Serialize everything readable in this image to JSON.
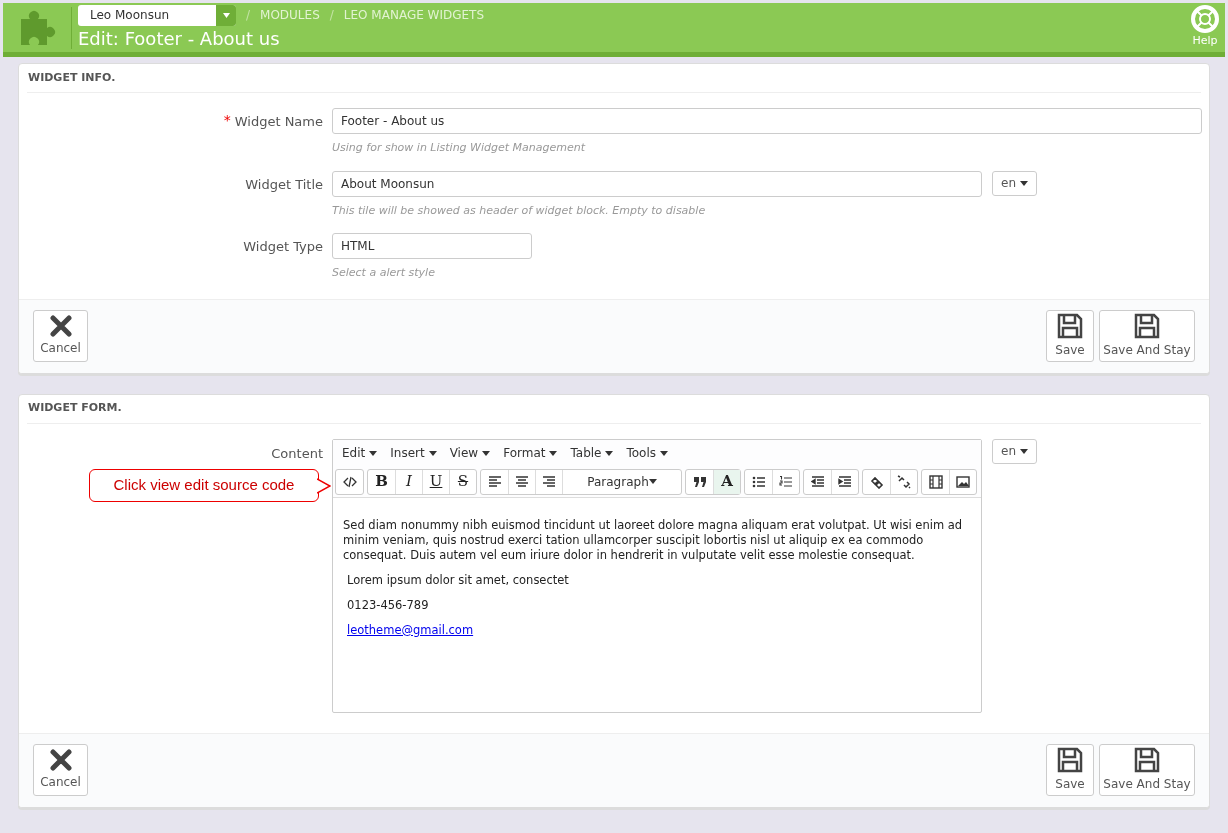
{
  "header": {
    "shop_select": "Leo Moonsun",
    "breadcrumbs": [
      {
        "separator": "/",
        "label": "MODULES"
      },
      {
        "separator": "/",
        "label": "LEO MANAGE WIDGETS"
      }
    ],
    "title": "Edit: Footer - About us",
    "help": "Help"
  },
  "widget_info": {
    "heading": "WIDGET INFO.",
    "fields": [
      {
        "label": "Widget Name",
        "required_mark": "*",
        "value": "Footer - About us",
        "hint": "Using for show in Listing Widget Management"
      },
      {
        "label": "Widget Title",
        "value": "About Moonsun",
        "hint": "This tile will be showed as header of widget block. Empty to disable",
        "lang": "en"
      },
      {
        "label": "Widget Type",
        "value": "HTML",
        "hint": "Select a alert style"
      }
    ],
    "buttons": {
      "cancel": "Cancel",
      "save": "Save",
      "save_stay": "Save And Stay"
    }
  },
  "widget_form": {
    "heading": "WIDGET FORM.",
    "label": "Content",
    "lang": "en",
    "menus": [
      "Edit",
      "Insert",
      "View",
      "Format",
      "Table",
      "Tools"
    ],
    "toolbar": [
      [
        {
          "kind": "icon"
        }
      ],
      [
        {
          "kind": "text",
          "label": "B"
        },
        {
          "kind": "text",
          "label": "I"
        },
        {
          "kind": "text",
          "label": "U"
        },
        {
          "kind": "text",
          "label": "S"
        }
      ],
      [
        {
          "kind": "icon"
        },
        {
          "kind": "icon"
        },
        {
          "kind": "icon"
        },
        {
          "kind": "select",
          "label": "Paragraph"
        }
      ],
      [
        {
          "kind": "icon"
        },
        {
          "kind": "text",
          "label": "A"
        }
      ],
      [
        {
          "kind": "icon"
        },
        {
          "kind": "icon"
        }
      ],
      [
        {
          "kind": "icon"
        },
        {
          "kind": "icon"
        }
      ],
      [
        {
          "kind": "icon"
        },
        {
          "kind": "icon"
        }
      ],
      [
        {
          "kind": "icon"
        },
        {
          "kind": "icon"
        }
      ]
    ],
    "content": [
      {
        "kind": "text",
        "text": "Sed diam nonummy nibh euismod tincidunt ut laoreet dolore magna aliquam erat volutpat. Ut wisi enim ad minim veniam, quis nostrud exerci tation ullamcorper suscipit lobortis nisl ut aliquip ex ea commodo consequat. Duis autem vel eum iriure dolor in hendrerit in vulputate velit esse molestie consequat."
      },
      {
        "kind": "text",
        "text": "Lorem ipsum dolor sit amet, consectet"
      },
      {
        "kind": "text",
        "text": "0123-456-789"
      },
      {
        "kind": "link",
        "text": "leotheme@gmail.com"
      }
    ],
    "callout": "Click view edit source code",
    "buttons": {
      "cancel": "Cancel",
      "save": "Save",
      "save_stay": "Save And Stay"
    }
  }
}
